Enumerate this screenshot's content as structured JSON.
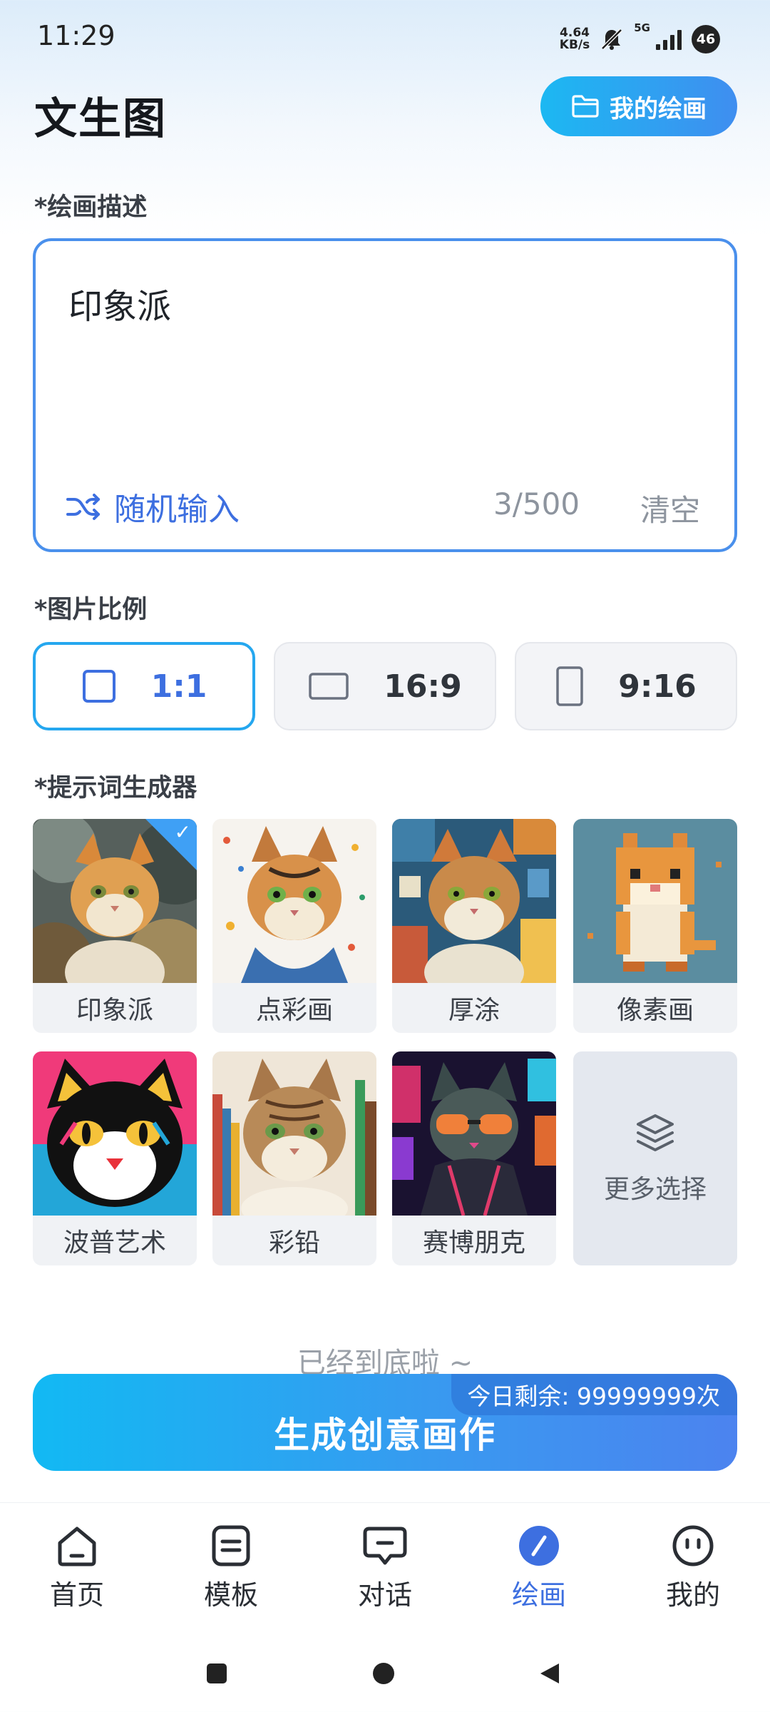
{
  "status_bar": {
    "time": "11:29",
    "net_speed_value": "4.64",
    "net_speed_unit": "KB/s",
    "network": "5G",
    "battery": "46"
  },
  "header": {
    "title": "文生图",
    "my_drawings_label": "我的绘画"
  },
  "prompt": {
    "section_label": "*绘画描述",
    "value": "印象派",
    "random_label": "随机输入",
    "count": "3/500",
    "clear_label": "清空"
  },
  "ratio": {
    "section_label": "*图片比例",
    "options": [
      {
        "label": "1:1",
        "selected": true
      },
      {
        "label": "16:9",
        "selected": false
      },
      {
        "label": "9:16",
        "selected": false
      }
    ]
  },
  "styles": {
    "section_label": "*提示词生成器",
    "items": [
      {
        "label": "印象派",
        "selected": true
      },
      {
        "label": "点彩画",
        "selected": false
      },
      {
        "label": "厚涂",
        "selected": false
      },
      {
        "label": "像素画",
        "selected": false
      },
      {
        "label": "波普艺术",
        "selected": false
      },
      {
        "label": "彩铅",
        "selected": false
      },
      {
        "label": "赛博朋克",
        "selected": false
      }
    ],
    "more_label": "更多选择"
  },
  "footer_hint": "已经到底啦 ~",
  "generate": {
    "label": "生成创意画作",
    "quota": "今日剩余: 99999999次"
  },
  "nav": {
    "items": [
      {
        "label": "首页",
        "icon": "home-icon"
      },
      {
        "label": "模板",
        "icon": "template-icon"
      },
      {
        "label": "对话",
        "icon": "chat-icon"
      },
      {
        "label": "绘画",
        "icon": "paint-icon",
        "active": true
      },
      {
        "label": "我的",
        "icon": "profile-icon"
      }
    ]
  },
  "colors": {
    "accent": "#3d6fe0",
    "button_gradient_start": "#12b9f3",
    "button_gradient_end": "#4c83ef"
  }
}
